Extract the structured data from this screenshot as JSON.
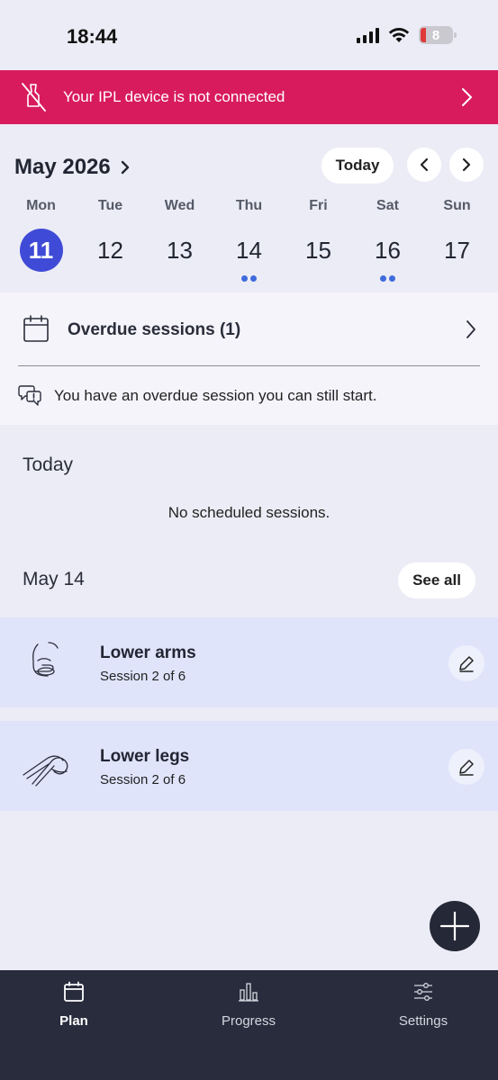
{
  "status_bar": {
    "time": "18:44",
    "battery": "8"
  },
  "alert": {
    "text": "Your IPL device is not connected"
  },
  "calendar": {
    "month_label": "May 2026",
    "today_label": "Today",
    "days": [
      {
        "name": "Mon",
        "num": "11",
        "selected": true,
        "dots": 0
      },
      {
        "name": "Tue",
        "num": "12",
        "selected": false,
        "dots": 0
      },
      {
        "name": "Wed",
        "num": "13",
        "selected": false,
        "dots": 0
      },
      {
        "name": "Thu",
        "num": "14",
        "selected": false,
        "dots": 2
      },
      {
        "name": "Fri",
        "num": "15",
        "selected": false,
        "dots": 0
      },
      {
        "name": "Sat",
        "num": "16",
        "selected": false,
        "dots": 2
      },
      {
        "name": "Sun",
        "num": "17",
        "selected": false,
        "dots": 0
      }
    ]
  },
  "overdue": {
    "title": "Overdue sessions (1)",
    "note": "You have an overdue session you can still start."
  },
  "today": {
    "heading": "Today",
    "empty": "No scheduled sessions."
  },
  "upcoming": {
    "date_heading": "May 14",
    "see_all": "See all",
    "sessions": [
      {
        "title": "Lower arms",
        "subtitle": "Session 2 of 6",
        "icon": "lower-arms-icon"
      },
      {
        "title": "Lower legs",
        "subtitle": "Session 2 of 6",
        "icon": "lower-legs-icon"
      }
    ]
  },
  "tabs": [
    {
      "label": "Plan",
      "icon": "calendar-icon",
      "active": true
    },
    {
      "label": "Progress",
      "icon": "bar-chart-icon",
      "active": false
    },
    {
      "label": "Settings",
      "icon": "sliders-icon",
      "active": false
    }
  ],
  "colors": {
    "alert_bg": "#d81b5c",
    "accent": "#3f4bd6",
    "card_bg": "#dfe4fb",
    "tab_bar_bg": "#292c3d"
  }
}
